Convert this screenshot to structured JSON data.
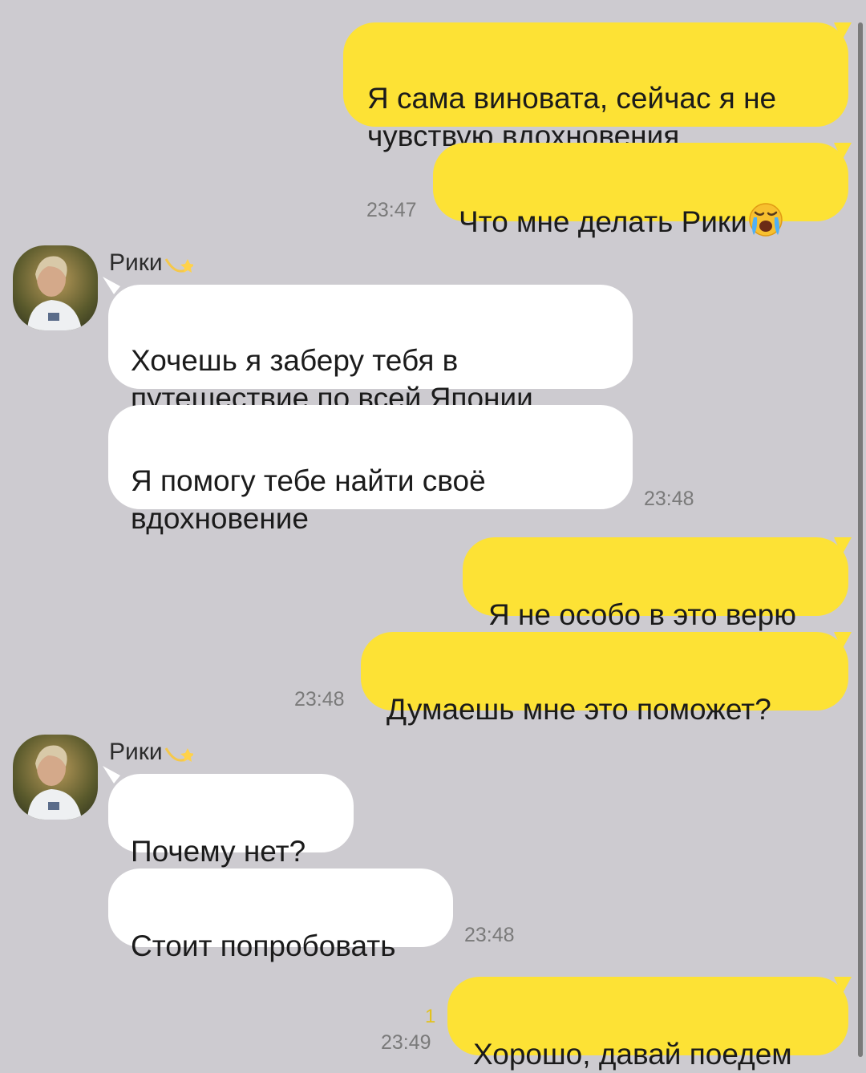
{
  "chat": {
    "contact_name": "Рики",
    "messages": [
      {
        "id": "m1",
        "direction": "out",
        "text": "Я сама виновата, сейчас я не\nчувствую вдохновения"
      },
      {
        "id": "m2",
        "direction": "out",
        "text": "Что мне делать Рики",
        "emoji": "loudly-crying-face",
        "time": "23:47"
      },
      {
        "id": "m3",
        "direction": "in",
        "text": "Хочешь я заберу тебя в\nпутешествие по всей Японии"
      },
      {
        "id": "m4",
        "direction": "in",
        "text": "Я помогу тебе найти своё\nвдохновение",
        "time": "23:48"
      },
      {
        "id": "m5",
        "direction": "out",
        "text": "Я не особо в это верю"
      },
      {
        "id": "m6",
        "direction": "out",
        "text": "Думаешь мне это поможет?",
        "time": "23:48"
      },
      {
        "id": "m7",
        "direction": "in",
        "text": "Почему нет?"
      },
      {
        "id": "m8",
        "direction": "in",
        "text": "Стоит попробовать",
        "time": "23:48"
      },
      {
        "id": "m9",
        "direction": "out",
        "text": "Хорошо, давай поедем",
        "time": "23:49",
        "unread_count": "1"
      }
    ]
  },
  "colors": {
    "background": "#cdcbd0",
    "outgoing_bubble": "#fde235",
    "incoming_bubble": "#ffffff",
    "timestamp": "#7a7a7a",
    "unread_count": "#e3c21a"
  },
  "icons": {
    "sender_badge": "dizzy-star-icon",
    "emoji": "loudly-crying-face-icon"
  }
}
